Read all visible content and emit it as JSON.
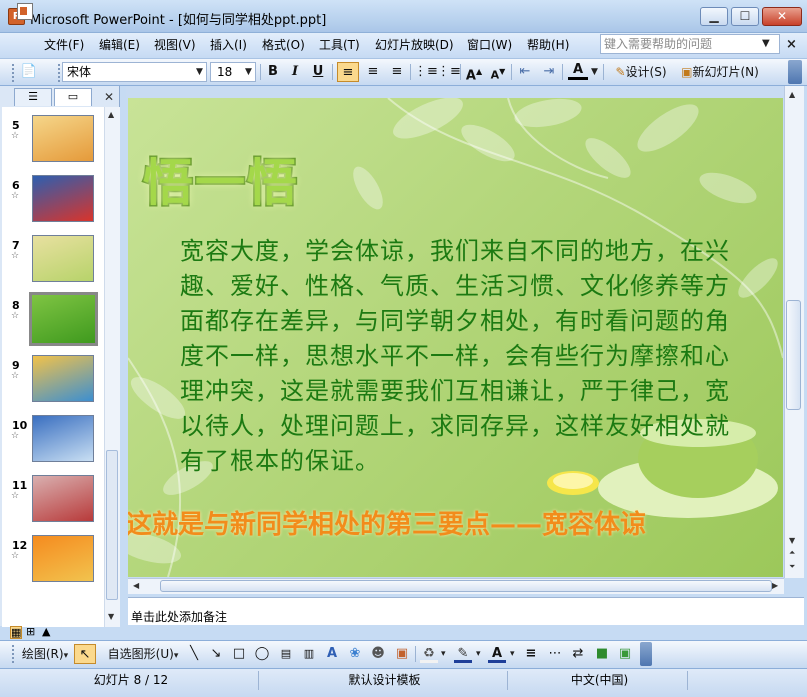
{
  "window": {
    "app_icon_letter": "P",
    "title": "Microsoft PowerPoint - [如何与同学相处ppt.ppt]",
    "minimize_glyph": "▁",
    "maximize_glyph": "☐",
    "close_glyph": "✕"
  },
  "menubar": {
    "items": [
      "文件(F)",
      "编辑(E)",
      "视图(V)",
      "插入(I)",
      "格式(O)",
      "工具(T)",
      "幻灯片放映(D)",
      "窗口(W)",
      "帮助(H)"
    ],
    "help_placeholder": "键入需要帮助的问题",
    "help_dropdown_glyph": "▼",
    "close_glyph": "×"
  },
  "toolbar": {
    "font_name": "宋体",
    "font_size": "18",
    "dropdown_glyph": "▼",
    "bold": "B",
    "italic": "I",
    "underline": "U",
    "design_label": "设计(S)",
    "new_slide_label": "新幻灯片(N)"
  },
  "left_pane": {
    "close_glyph": "✕",
    "star_glyph": "☆",
    "slides": [
      {
        "number": "5",
        "colors": [
          "#f5d68a",
          "#e59a3a"
        ]
      },
      {
        "number": "6",
        "colors": [
          "#2d5fb0",
          "#d9342b"
        ]
      },
      {
        "number": "7",
        "colors": [
          "#e8e0a0",
          "#b7d36a"
        ]
      },
      {
        "number": "8",
        "colors": [
          "#7fc443",
          "#3f9a1e"
        ],
        "selected": true
      },
      {
        "number": "9",
        "colors": [
          "#f2c24a",
          "#3d8fd0"
        ]
      },
      {
        "number": "10",
        "colors": [
          "#3a6fc0",
          "#c9dff3"
        ]
      },
      {
        "number": "11",
        "colors": [
          "#d9b0b0",
          "#b83a3a"
        ]
      },
      {
        "number": "12",
        "colors": [
          "#f58b1f",
          "#f2c34e"
        ]
      }
    ]
  },
  "slide": {
    "heading": "悟一悟",
    "body": "宽容大度，学会体谅，我们来自不同的地方，在兴趣、爱好、性格、气质、生活习惯、文化修养等方面都存在差异，与同学朝夕相处，有时看问题的角度不一样，思想水平不一样，会有些行为摩擦和心理冲突，这是就需要我们互相谦让，严于律己，宽以待人，处理问题上，求同存异，这样友好相处就有了根本的保证。",
    "footer": "这就是与新同学相处的第三要点——宽容体谅"
  },
  "notes": {
    "placeholder": "单击此处添加备注"
  },
  "drawbar": {
    "draw_label": "绘图(R)",
    "autoshape_label": "自选图形(U)"
  },
  "status": {
    "slide_counter": "幻灯片 8 / 12",
    "template": "默认设计模板",
    "language": "中文(中国)"
  },
  "colors": {
    "accent_highlight": "#fbd98d",
    "slide_text": "#1c7a12",
    "slide_footer": "#f28c1b"
  }
}
